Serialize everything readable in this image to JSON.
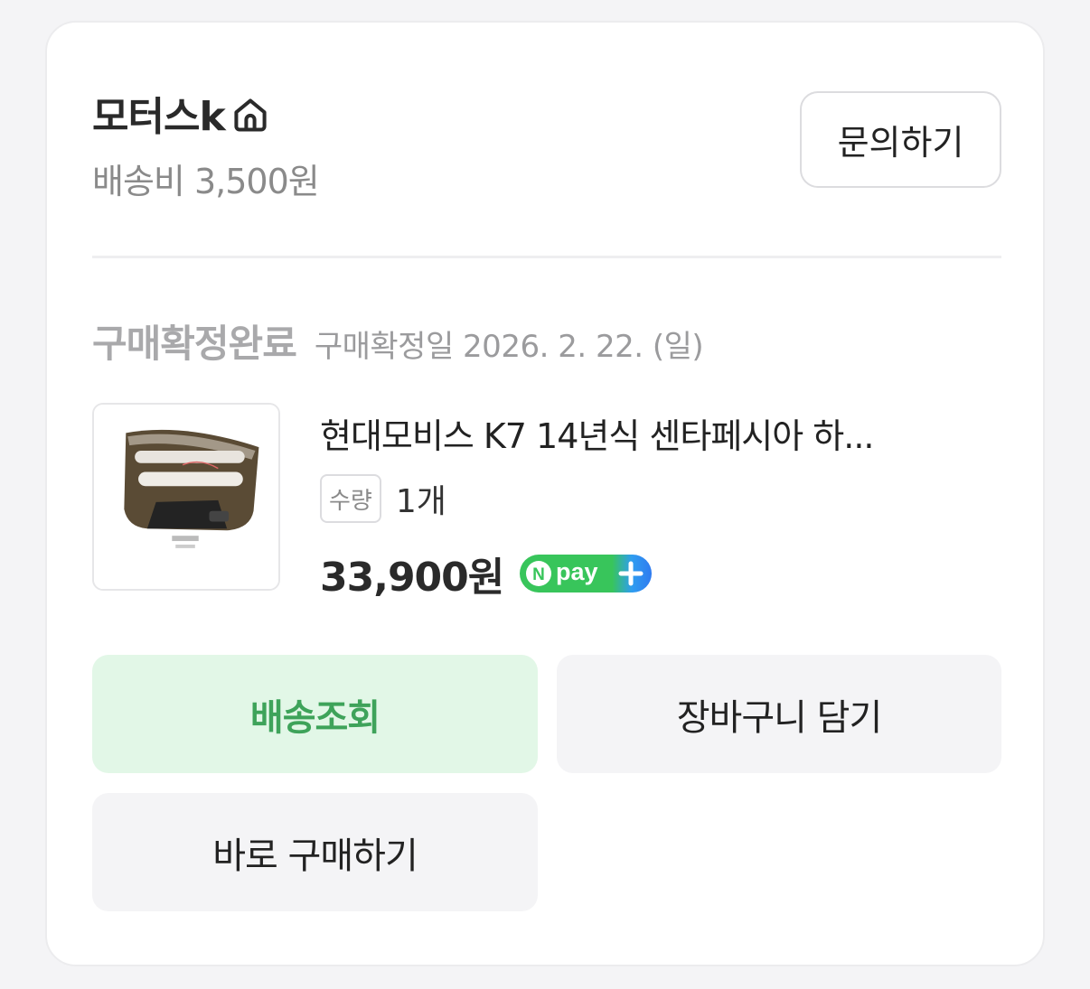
{
  "store": {
    "name": "모터스k",
    "shipping_fee": "배송비 3,500원",
    "inquiry_label": "문의하기"
  },
  "order": {
    "status": "구매확정완료",
    "confirm_date": "구매확정일 2026. 2. 22. (일)"
  },
  "product": {
    "title": "현대모비스 K7 14년식 센타페시아 하...",
    "quantity_label": "수량",
    "quantity_value": "1개",
    "price": "33,900원",
    "payment_badge": "Npay+"
  },
  "actions": {
    "track_label": "배송조회",
    "cart_label": "장바구니 담기",
    "buy_label": "바로 구매하기"
  },
  "colors": {
    "accent_green": "#3ea35a",
    "track_bg": "#e2f7e7",
    "secondary_bg": "#f4f4f6"
  }
}
